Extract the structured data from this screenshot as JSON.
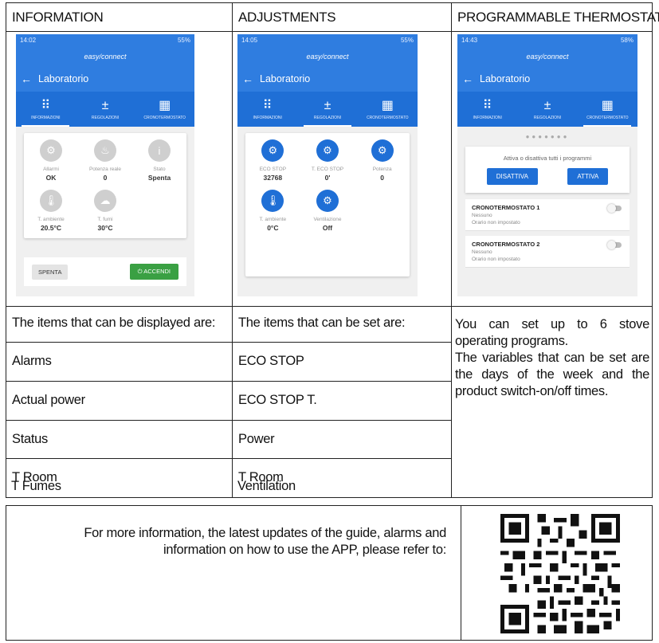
{
  "headers": [
    "INFORMATION",
    "ADJUSTMENTS",
    "PROGRAMMABLE THERMOSTAT"
  ],
  "col1": [
    "The items that can be displayed are:",
    "Alarms",
    "Actual power",
    "Status",
    "T Room",
    "T Fumes"
  ],
  "col2": [
    "The items that can be set are:",
    "ECO STOP",
    "ECO STOP T.",
    "Power",
    "T Room",
    "Ventilation"
  ],
  "col3_note": "You can set up to 6 stove operating programs.\nThe variables that can be set are the days of the week and the product switch-on/off times.",
  "more_info": "For more information, the latest updates of the guide, alarms and information on how to use the APP, please refer to:",
  "app": {
    "brand": "easy/connect",
    "title": "Laboratorio",
    "tabs": [
      "INFORMAZIONI",
      "REGOLAZIONI",
      "CRONOTERMOSTATO"
    ]
  },
  "phone1": {
    "status_time": "14:02",
    "status_right": "55%",
    "items": [
      {
        "label": "Allarmi",
        "value": "OK",
        "icon": "gears-icon"
      },
      {
        "label": "Potenza reale",
        "value": "0",
        "icon": "flame-icon"
      },
      {
        "label": "Stato",
        "value": "Spenta",
        "icon": "info-icon"
      },
      {
        "label": "T. ambiente",
        "value": "20.5°C",
        "icon": "thermometer-icon"
      },
      {
        "label": "T. fumi",
        "value": "30°C",
        "icon": "smoke-icon"
      }
    ],
    "off_button": "SPENTA",
    "on_button": "ACCENDI"
  },
  "phone2": {
    "status_time": "14:05",
    "status_right": "55%",
    "items": [
      {
        "label": "ECO STOP",
        "value": "32768",
        "icon": "gears-icon"
      },
      {
        "label": "T. ECO STOP",
        "value": "0'",
        "icon": "gears-icon"
      },
      {
        "label": "Potenza",
        "value": "0",
        "icon": "gears-icon"
      },
      {
        "label": "T. ambiente",
        "value": "0°C",
        "icon": "thermometer-icon"
      },
      {
        "label": "Ventilazione",
        "value": "Off",
        "icon": "gears-icon"
      }
    ]
  },
  "phone3": {
    "status_time": "14:43",
    "status_right": "58%",
    "prog_title": "Attiva o disattiva tutti i programmi",
    "btn_disable": "DISATTIVA",
    "btn_enable": "ATTIVA",
    "chronos": [
      {
        "title": "CRONOTERMOSTATO 1",
        "line1": "Nessuno",
        "line2": "Orario non impostato"
      },
      {
        "title": "CRONOTERMOSTATO 2",
        "line1": "Nessuno",
        "line2": "Orario non impostato"
      }
    ]
  },
  "colors": {
    "primary": "#2f7de0",
    "tab": "#1f6fd6",
    "green": "#3aa043"
  }
}
